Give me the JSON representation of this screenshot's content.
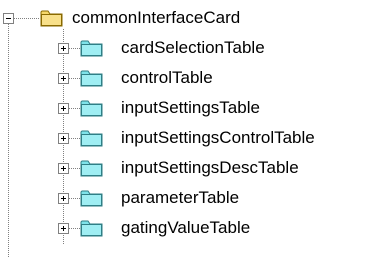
{
  "tree": {
    "root": {
      "label": "commonInterfaceCard",
      "icon": "folder-icon",
      "folder_color": "#f6d86b",
      "expander": "minus"
    },
    "children": [
      {
        "label": "cardSelectionTable",
        "icon": "folder-icon",
        "expander": "plus"
      },
      {
        "label": "controlTable",
        "icon": "folder-icon",
        "expander": "plus"
      },
      {
        "label": "inputSettingsTable",
        "icon": "folder-icon",
        "expander": "plus"
      },
      {
        "label": "inputSettingsControlTable",
        "icon": "folder-icon",
        "expander": "plus"
      },
      {
        "label": "inputSettingsDescTable",
        "icon": "folder-icon",
        "expander": "plus"
      },
      {
        "label": "parameterTable",
        "icon": "folder-icon",
        "expander": "plus"
      },
      {
        "label": "gatingValueTable",
        "icon": "folder-icon",
        "expander": "plus"
      }
    ],
    "child_folder_color": "#7fe3ea",
    "line_color": "#808080"
  }
}
